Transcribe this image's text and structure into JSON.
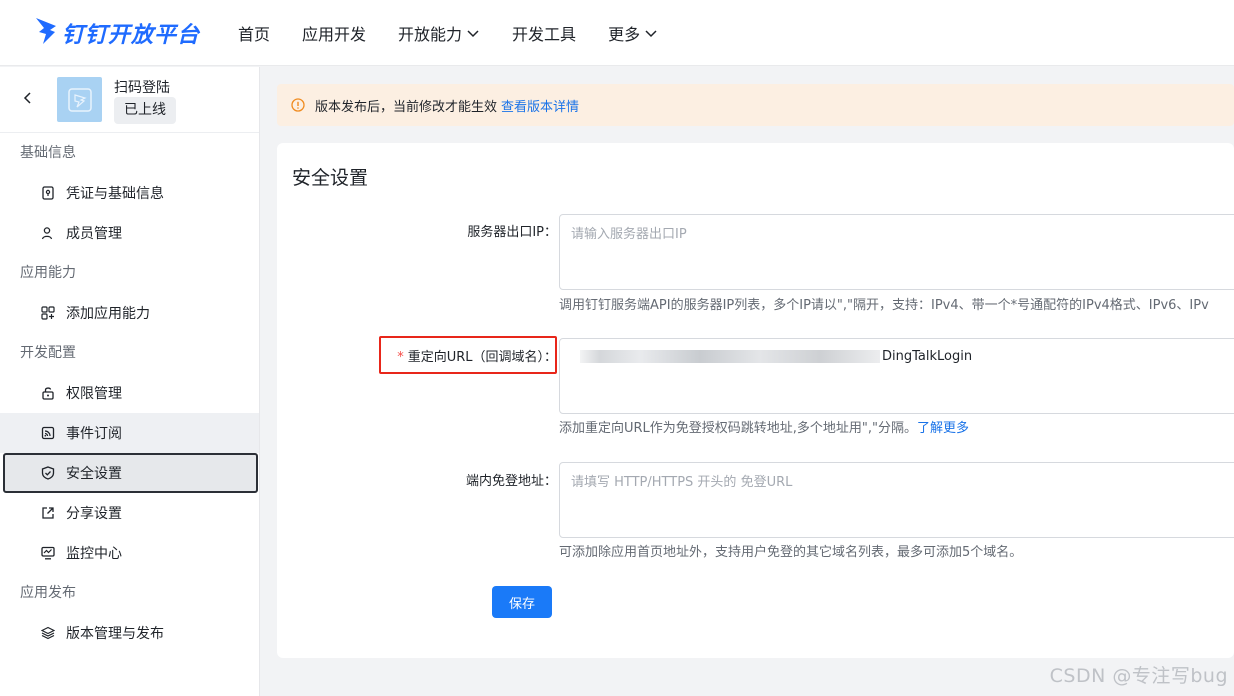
{
  "brand": {
    "name": "钉钉开放平台",
    "color": "#1f6bff",
    "logo_icon": "dingtalk-wing-icon"
  },
  "nav": {
    "items": [
      {
        "label": "首页",
        "dropdown": false
      },
      {
        "label": "应用开发",
        "dropdown": false
      },
      {
        "label": "开放能力",
        "dropdown": true
      },
      {
        "label": "开发工具",
        "dropdown": false
      },
      {
        "label": "更多",
        "dropdown": true
      }
    ]
  },
  "app": {
    "name": "扫码登陆",
    "status": "已上线",
    "icon": "app-placeholder-icon"
  },
  "sidebar": {
    "sections": [
      {
        "title": "基础信息",
        "items": [
          {
            "label": "凭证与基础信息",
            "icon": "credential-icon"
          },
          {
            "label": "成员管理",
            "icon": "user-icon"
          }
        ]
      },
      {
        "title": "应用能力",
        "items": [
          {
            "label": "添加应用能力",
            "icon": "grid-add-icon"
          }
        ]
      },
      {
        "title": "开发配置",
        "items": [
          {
            "label": "权限管理",
            "icon": "lock-icon"
          },
          {
            "label": "事件订阅",
            "icon": "rss-icon"
          },
          {
            "label": "安全设置",
            "icon": "shield-icon"
          },
          {
            "label": "分享设置",
            "icon": "share-icon"
          },
          {
            "label": "监控中心",
            "icon": "monitor-icon"
          }
        ]
      },
      {
        "title": "应用发布",
        "items": [
          {
            "label": "版本管理与发布",
            "icon": "layers-icon"
          }
        ]
      }
    ],
    "active": "安全设置"
  },
  "notice": {
    "text": "版本发布后，当前修改才能生效",
    "link": "查看版本详情",
    "icon": "warning-circle-icon",
    "bg": "#fcefe2"
  },
  "security": {
    "title": "安全设置",
    "ip": {
      "label": "服务器出口IP：",
      "placeholder": "请输入服务器出口IP",
      "help": "调用钉钉服务端API的服务器IP列表，多个IP请以\",\"隔开，支持：IPv4、带一个*号通配符的IPv4格式、IPv6、IPv"
    },
    "redirect": {
      "required_mark": "*",
      "label": "重定向URL（回调域名）：",
      "value_suffix": "DingTalkLogin",
      "help": "添加重定向URL作为免登授权码跳转地址,多个地址用\",\"分隔。",
      "help_link": "了解更多"
    },
    "sso": {
      "label": "端内免登地址：",
      "placeholder": "请填写 HTTP/HTTPS 开头的 免登URL",
      "help": "可添加除应用首页地址外，支持用户免登的其它域名列表，最多可添加5个域名。"
    },
    "save_label": "保存"
  },
  "watermark": "CSDN @专注写bug",
  "colors": {
    "primary": "#1a7af8",
    "highlight_box": "#e8261a",
    "required": "#f54a45"
  }
}
